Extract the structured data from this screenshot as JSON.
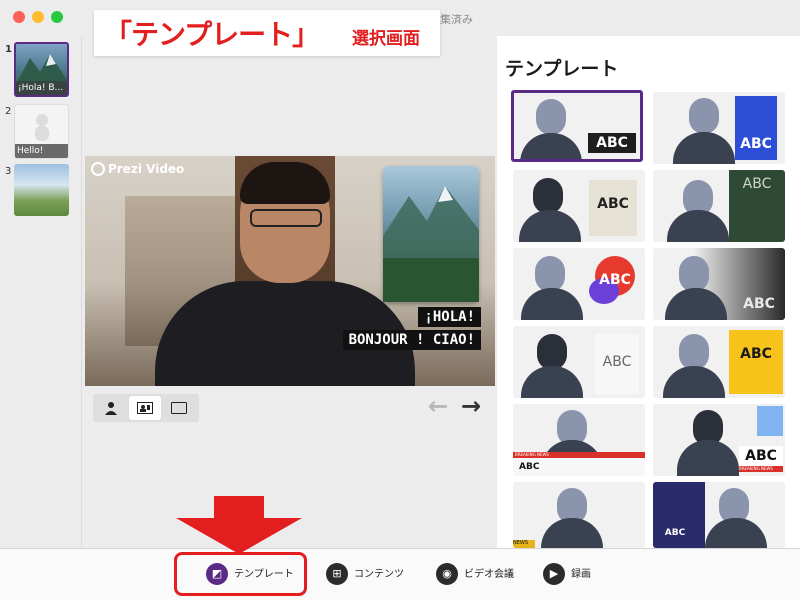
{
  "window": {
    "title_fragment": "集済み"
  },
  "banner": {
    "main": "「テンプレート」",
    "sub": "選択画面"
  },
  "sidebar": {
    "slides": [
      {
        "number": "1",
        "label": "¡Hola! B...",
        "selected": true
      },
      {
        "number": "2",
        "label": "Hello!",
        "selected": false
      },
      {
        "number": "3",
        "label": "",
        "selected": false
      }
    ]
  },
  "video": {
    "brand": "Prezi Video",
    "overlay_lines": [
      "¡HOLA!",
      "BONJOUR ! CIAO!"
    ]
  },
  "controls": {
    "layout_icons": [
      "person-icon",
      "picture-in-picture-icon",
      "screen-icon"
    ],
    "arrow_left": "←",
    "arrow_right": "→"
  },
  "panel": {
    "title": "テンプレート",
    "templates": [
      {
        "label": "ABC",
        "style": "dark-box",
        "selected": true
      },
      {
        "label": "ABC",
        "style": "blue-panel",
        "selected": false
      },
      {
        "label": "ABC",
        "style": "beige-box",
        "selected": false
      },
      {
        "label": "ABC",
        "style": "green-board",
        "selected": false
      },
      {
        "label": "ABC",
        "style": "colorful-bubbles",
        "selected": false
      },
      {
        "label": "ABC",
        "style": "gradient-dark",
        "selected": false
      },
      {
        "label": "ABC",
        "style": "light-gray",
        "selected": false
      },
      {
        "label": "ABC",
        "style": "yellow-panel",
        "selected": false
      },
      {
        "label": "ABC",
        "style": "news-ticker",
        "selected": false,
        "tag": "BREAKING NEWS"
      },
      {
        "label": "ABC",
        "style": "blue-card",
        "selected": false,
        "tag": "BREAKING NEWS"
      },
      {
        "label": "",
        "style": "news",
        "selected": false,
        "tag": "NEWS"
      },
      {
        "label": "ABC",
        "style": "navy-split",
        "selected": false
      }
    ]
  },
  "bottom_nav": {
    "template": "テンプレート",
    "contents": "コンテンツ",
    "video_meeting": "ビデオ会議",
    "record": "録画"
  },
  "colors": {
    "accent": "#5b2a86",
    "annotation_red": "#e31e1e"
  }
}
